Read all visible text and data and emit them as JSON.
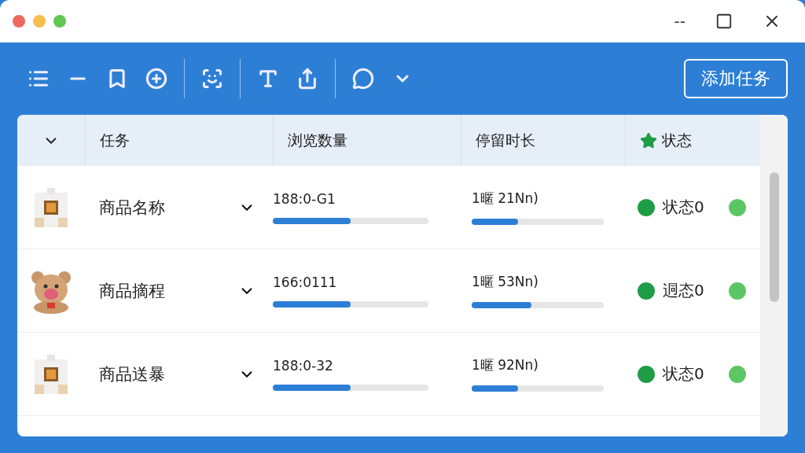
{
  "window": {
    "controls": [
      "--"
    ]
  },
  "toolbar": {
    "button": "添加任务"
  },
  "table": {
    "columns": [
      "任务",
      "浏览数量",
      "停留时长",
      "状态"
    ],
    "rows": [
      {
        "name": "商品名称",
        "views": {
          "text": "188:0-G1",
          "level": 0.5
        },
        "duration": {
          "text": "1暱 21Nn)",
          "level": 0.35
        },
        "status": "状态0"
      },
      {
        "name": "商品摘程",
        "views": {
          "text": "166:0111",
          "level": 0.5
        },
        "duration": {
          "text": "1暱 53Nn)",
          "level": 0.45
        },
        "status": "迵态0"
      },
      {
        "name": "商品送暴",
        "views": {
          "text": "188:0-32",
          "level": 0.5
        },
        "duration": {
          "text": "1暱 92Nn)",
          "level": 0.35
        },
        "status": "状态0"
      }
    ]
  }
}
